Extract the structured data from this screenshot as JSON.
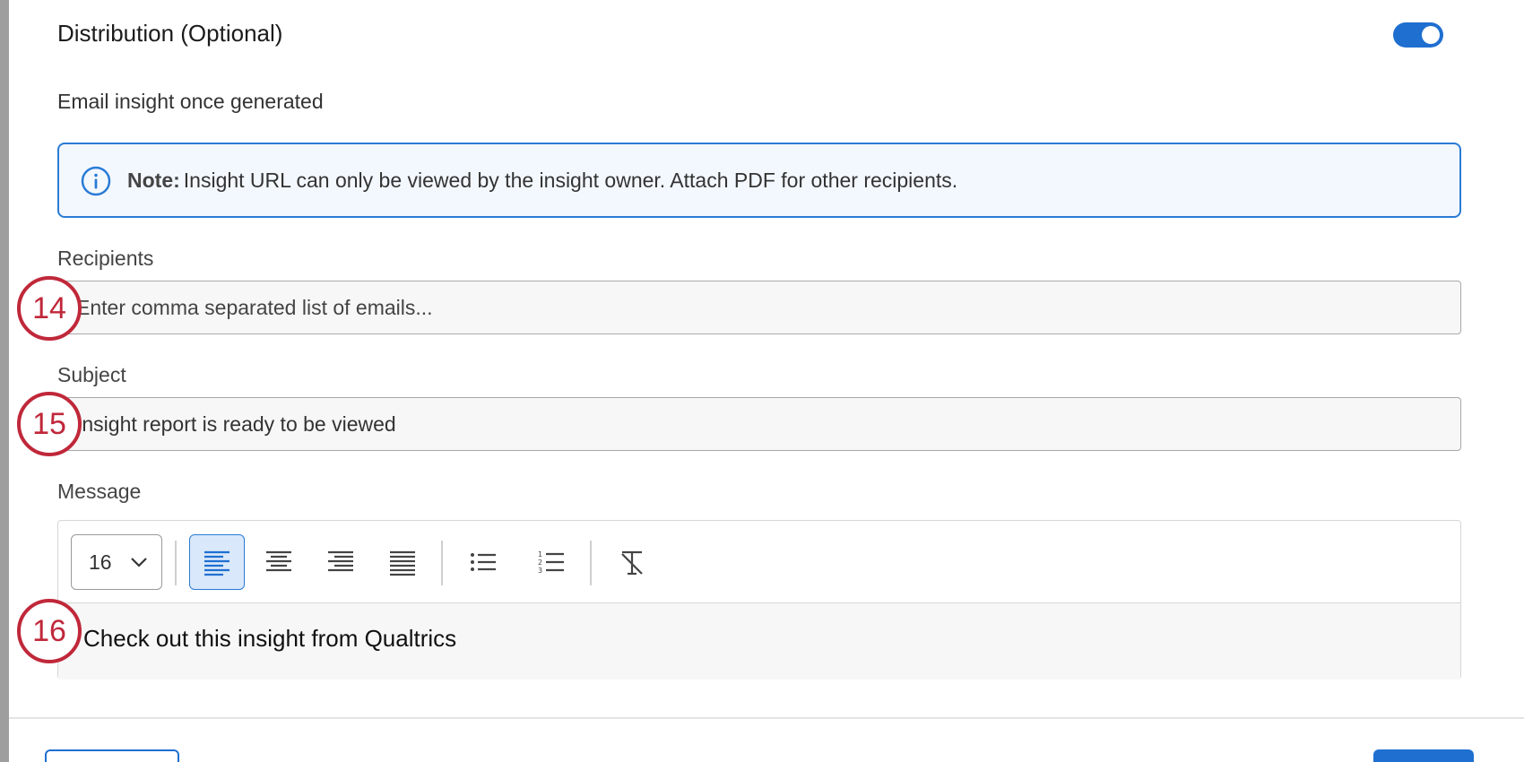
{
  "distribution": {
    "title": "Distribution (Optional)",
    "toggle_on": true,
    "email_label": "Email insight once generated"
  },
  "note": {
    "icon": "info-icon",
    "strong": "Note:",
    "text": "Insight URL can only be viewed by the insight owner. Attach PDF for other recipients."
  },
  "recipients": {
    "label": "Recipients",
    "placeholder": "Enter comma separated list of emails...",
    "value": ""
  },
  "subject": {
    "label": "Subject",
    "value": "Insight report is ready to be viewed"
  },
  "message": {
    "label": "Message",
    "font_size": "16",
    "toolbar": [
      "align-left-icon",
      "align-center-icon",
      "align-right-icon",
      "align-justify-icon",
      "bullet-list-icon",
      "numbered-list-icon",
      "clear-formatting-icon"
    ],
    "active_tool": "align-left-icon",
    "body": "Check out this insight from Qualtrics"
  },
  "callouts": [
    "14",
    "15",
    "16"
  ],
  "colors": {
    "accent": "#1f6fd1",
    "callout": "#c0283a",
    "note_bg": "#f3f8fe"
  }
}
